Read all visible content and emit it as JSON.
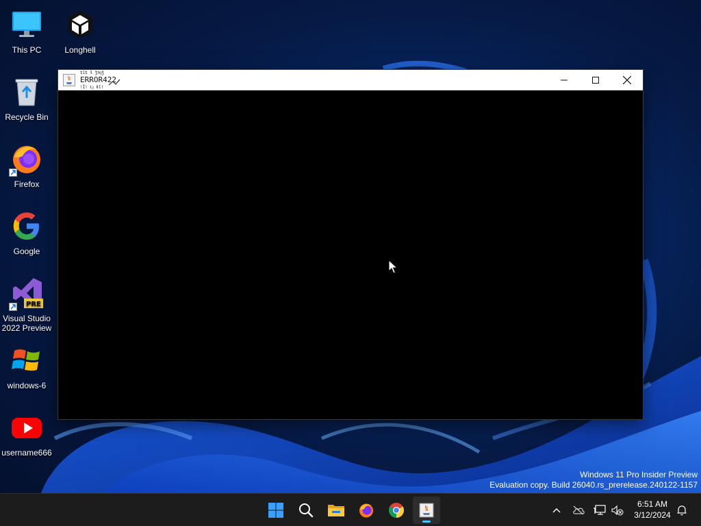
{
  "desktop": {
    "icons": [
      {
        "label": "This PC",
        "icon": "monitor-icon"
      },
      {
        "label": "Longhell",
        "icon": "unity-icon"
      },
      {
        "label": "Recycle Bin",
        "icon": "recycle-bin-icon"
      },
      {
        "label": "Firefox",
        "icon": "firefox-icon"
      },
      {
        "label": "Google",
        "icon": "google-icon"
      },
      {
        "label": "Visual Studio 2022 Preview",
        "icon": "visual-studio-preview-icon",
        "badge": "PRE"
      },
      {
        "label": "windows-6",
        "icon": "windows-flag-icon"
      },
      {
        "label": "username666",
        "icon": "youtube-icon"
      }
    ]
  },
  "window": {
    "title": "ERROR422",
    "icon": "java-icon",
    "controls": {
      "minimize": "minimize-icon",
      "maximize": "maximize-icon",
      "close": "close-icon"
    }
  },
  "watermark": {
    "line1": "Windows 11 Pro Insider Preview",
    "line2": "Evaluation copy. Build 26040.rs_prerelease.240122-1157"
  },
  "taskbar": {
    "apps": [
      "start-icon",
      "search-icon",
      "file-explorer-icon",
      "firefox-icon",
      "chrome-icon",
      "java-icon"
    ],
    "active_app": "java-icon",
    "tray": [
      "chevron-up-icon",
      "onedrive-icon",
      "network-icon",
      "volume-muted-icon"
    ],
    "time": "6:51 AM",
    "date": "3/12/2024",
    "notification": "bell-icon"
  },
  "colors": {
    "accent": "#4cc2ff",
    "taskbar_bg": "#1c1c1c",
    "window_content": "#000000"
  }
}
